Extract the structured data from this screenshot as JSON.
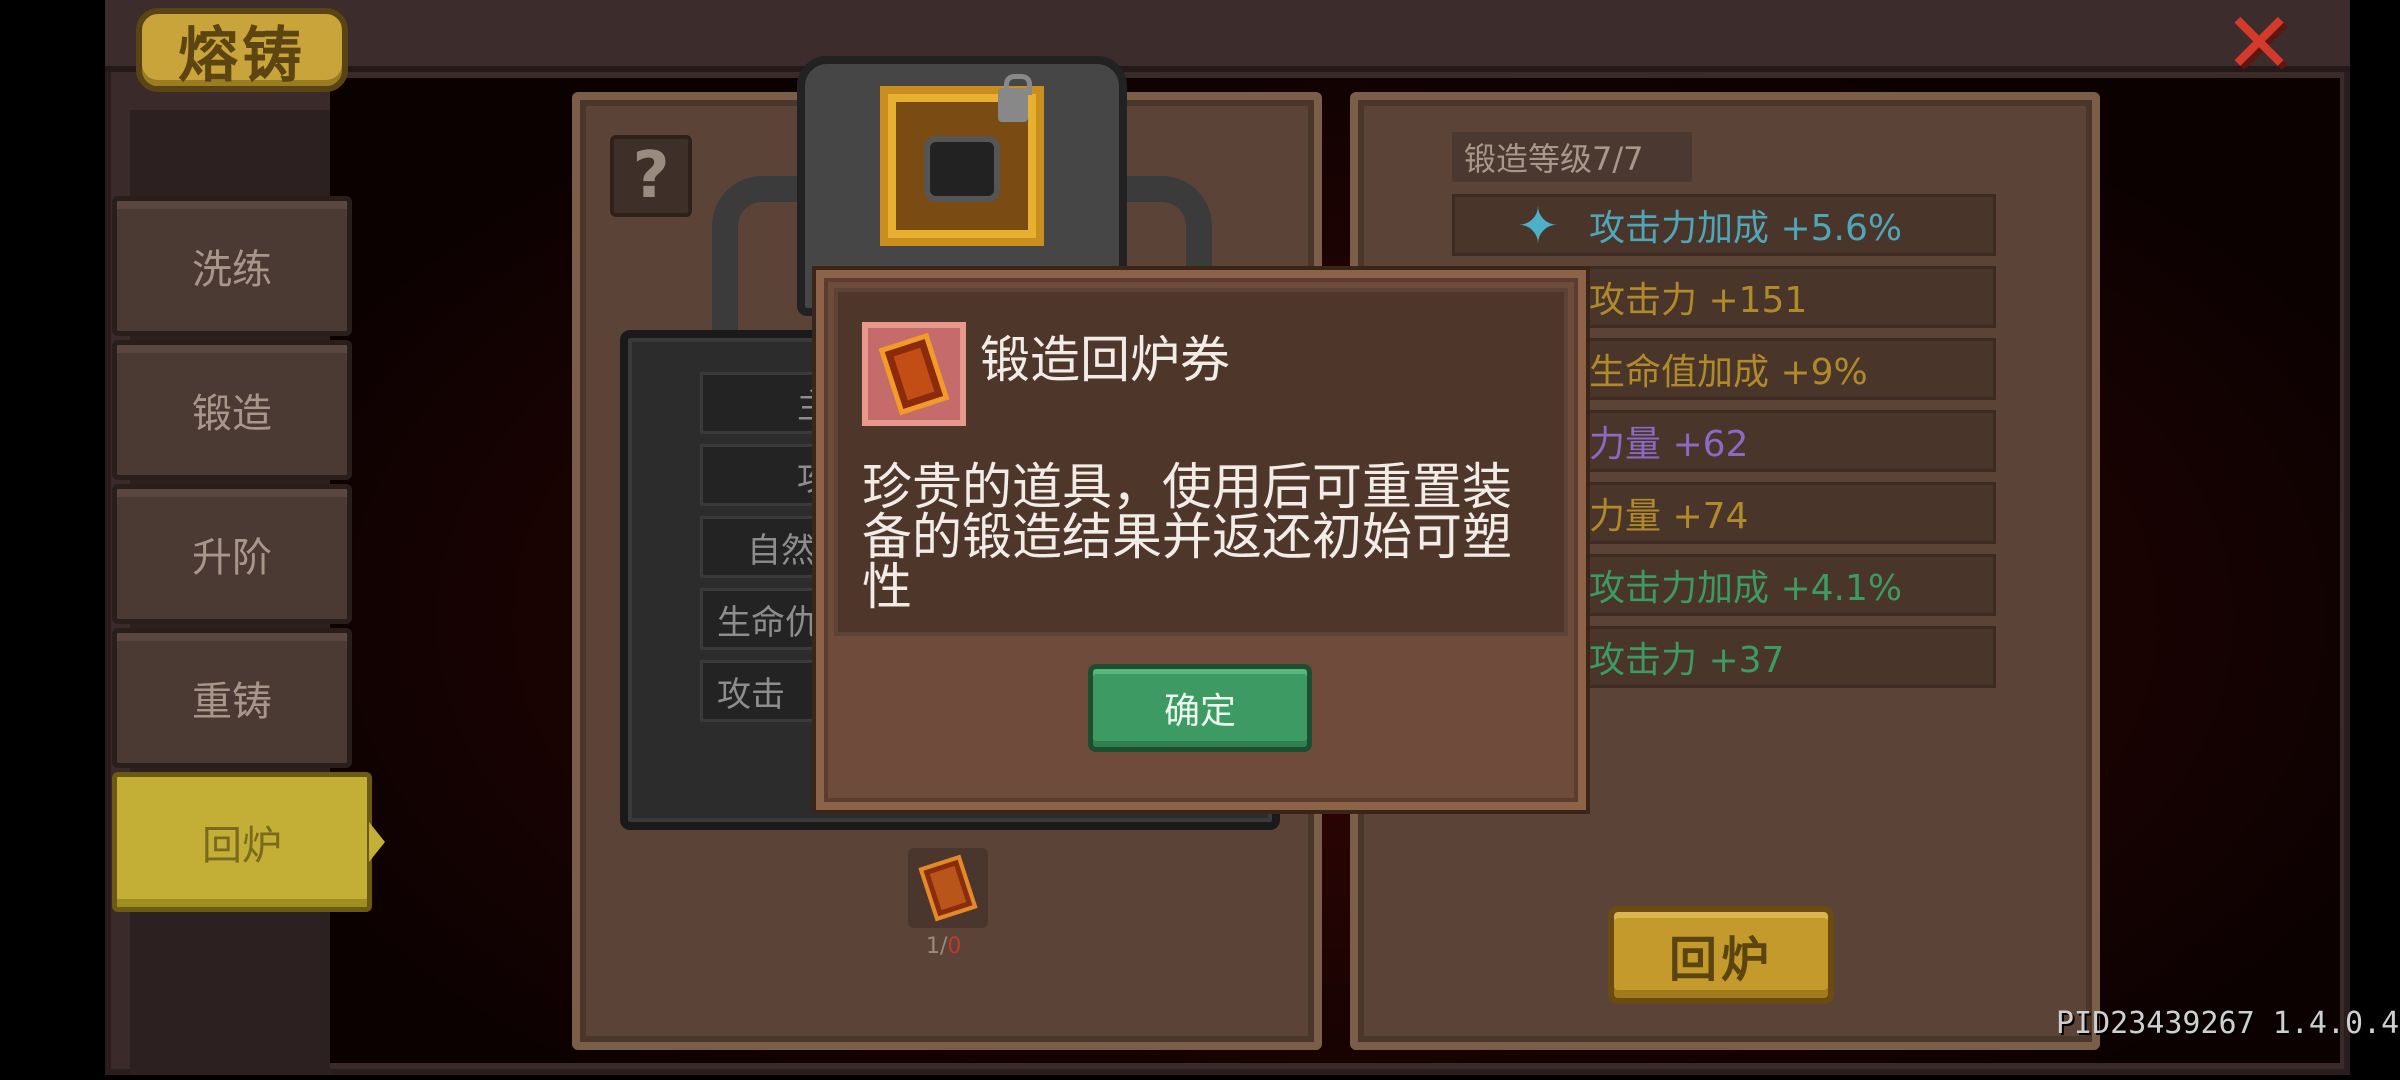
{
  "header": {
    "title": "熔铸",
    "close_label": "✕"
  },
  "sidebar": {
    "tabs": [
      {
        "label": "洗练"
      },
      {
        "label": "锻造"
      },
      {
        "label": "升阶"
      },
      {
        "label": "重铸"
      },
      {
        "label": "回炉",
        "active": true
      }
    ]
  },
  "left_panel": {
    "help_label": "?",
    "stat_lines": [
      "主",
      "攻",
      "自然",
      "生命仇",
      "攻击"
    ],
    "ticket": {
      "owned": "1",
      "separator": "/",
      "required": "0"
    }
  },
  "right_panel": {
    "level": "锻造等级7/7",
    "attributes": [
      {
        "text": "攻击力加成 +5.6%",
        "color": "#4fa6b8",
        "icon": "star-icon"
      },
      {
        "text": "攻击力 +151",
        "color": "#b08a2a"
      },
      {
        "text": "生命值加成 +9%",
        "color": "#b08a2a"
      },
      {
        "text": "力量 +62",
        "color": "#8a6ac2"
      },
      {
        "text": "力量 +74",
        "color": "#b08a2a"
      },
      {
        "text": "攻击力加成 +4.1%",
        "color": "#3d9a63"
      },
      {
        "text": "攻击力 +37",
        "color": "#3d9a63"
      }
    ],
    "remelt_label": "回炉"
  },
  "dialog": {
    "title": "锻造回炉券",
    "description": "珍贵的道具，使用后可重置装备的锻造结果并返还初始可塑性",
    "confirm_label": "确定"
  },
  "footer": {
    "version": "PID23439267 1.4.0.4"
  }
}
